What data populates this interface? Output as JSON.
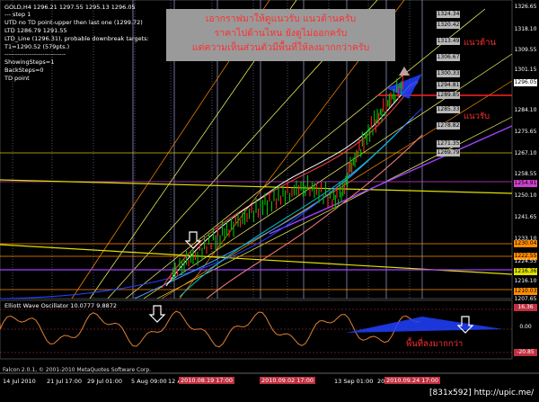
{
  "header": {
    "symbol_line": "GOLD,H4  1296.21 1297.55 1295.13 1296.05",
    "step_line": "---  step 1",
    "utd_line": "UTD no TD point-upper then last one (1299.72)",
    "ltd_line": "LTD  1286.79  1291.55",
    "ltd_targets_line": "LTD_Line (1296.31), probable downbreak targets:",
    "t1_line": "T1=1290.52 (579pts.)",
    "sep_line": "-----------------------------",
    "showing_steps": "ShowingSteps=1",
    "backsteps": "BackSteps=0",
    "td_point": "TD point"
  },
  "annotation": {
    "line1": "เอากราฟมาให้ดูแนวรับ แนวต้านครับ",
    "line2": "ราคาไปด้านไหน ยังดูไม่ออกครับ",
    "line3": "แต่ความเห็นส่วนตัวมีพื้นที่ให้ลงมากกว่าครับ",
    "resistance": "แนวต้าน",
    "support": "แนวรับ",
    "oscillator_note": "พื้นที่ลงมากกว่า"
  },
  "price_axis": {
    "ticks": [
      "1326.65",
      "1318.10",
      "1309.55",
      "1301.15",
      "1292.60",
      "1284.10",
      "1275.65",
      "1267.10",
      "1258.55",
      "1250.10",
      "1241.65",
      "1233.10",
      "1224.55",
      "1216.10",
      "1207.65"
    ],
    "current_price": "1296.05",
    "red_line_price": "1289.85",
    "tags": [
      {
        "text": "1254.91",
        "color": "#d040d0"
      },
      {
        "text": "1230.04",
        "color": "#ff8c00"
      },
      {
        "text": "1222.55",
        "color": "#ff8c00"
      },
      {
        "text": "1216.36",
        "color": "#e0e000"
      },
      {
        "text": "1210.03",
        "color": "#ff8c00"
      }
    ]
  },
  "fib_levels": [
    "1324.34",
    "1320.42",
    "1313.49",
    "1306.67",
    "1300.33",
    "1294.81",
    "1289.85",
    "1285.33",
    "1278.82",
    "1271.35",
    "1269.79"
  ],
  "oscillator": {
    "title": "Elliott Wave Oscillator 10.0777 9.8872",
    "axis_ticks": [
      "16.36",
      "0.00",
      "-20.85"
    ]
  },
  "time_axis": {
    "labels": [
      "14 Jul 2010",
      "21 Jul 17:00",
      "29 Jul 01:00",
      "5 Aug 09:00",
      "12 A",
      "13 Sep 01:00",
      "20"
    ],
    "highlighted": [
      "2010.08.19 17:00",
      "2010.09.02 17:00",
      "2010.09.24 17:00"
    ]
  },
  "footer": {
    "copyright": "Falcon 2.0.1, © 2001-2010 MetaQuotes Software Corp.",
    "watermark": "[831x592] http://upic.me/"
  },
  "colors": {
    "background": "#000000",
    "candle_up": "#00c000",
    "candle_down": "#ff2020",
    "grid": "#1a2a4a",
    "annotation_box": "#9a9a9a",
    "annotation_text": "#ff3030",
    "oscillator_line": "#e08030"
  }
}
